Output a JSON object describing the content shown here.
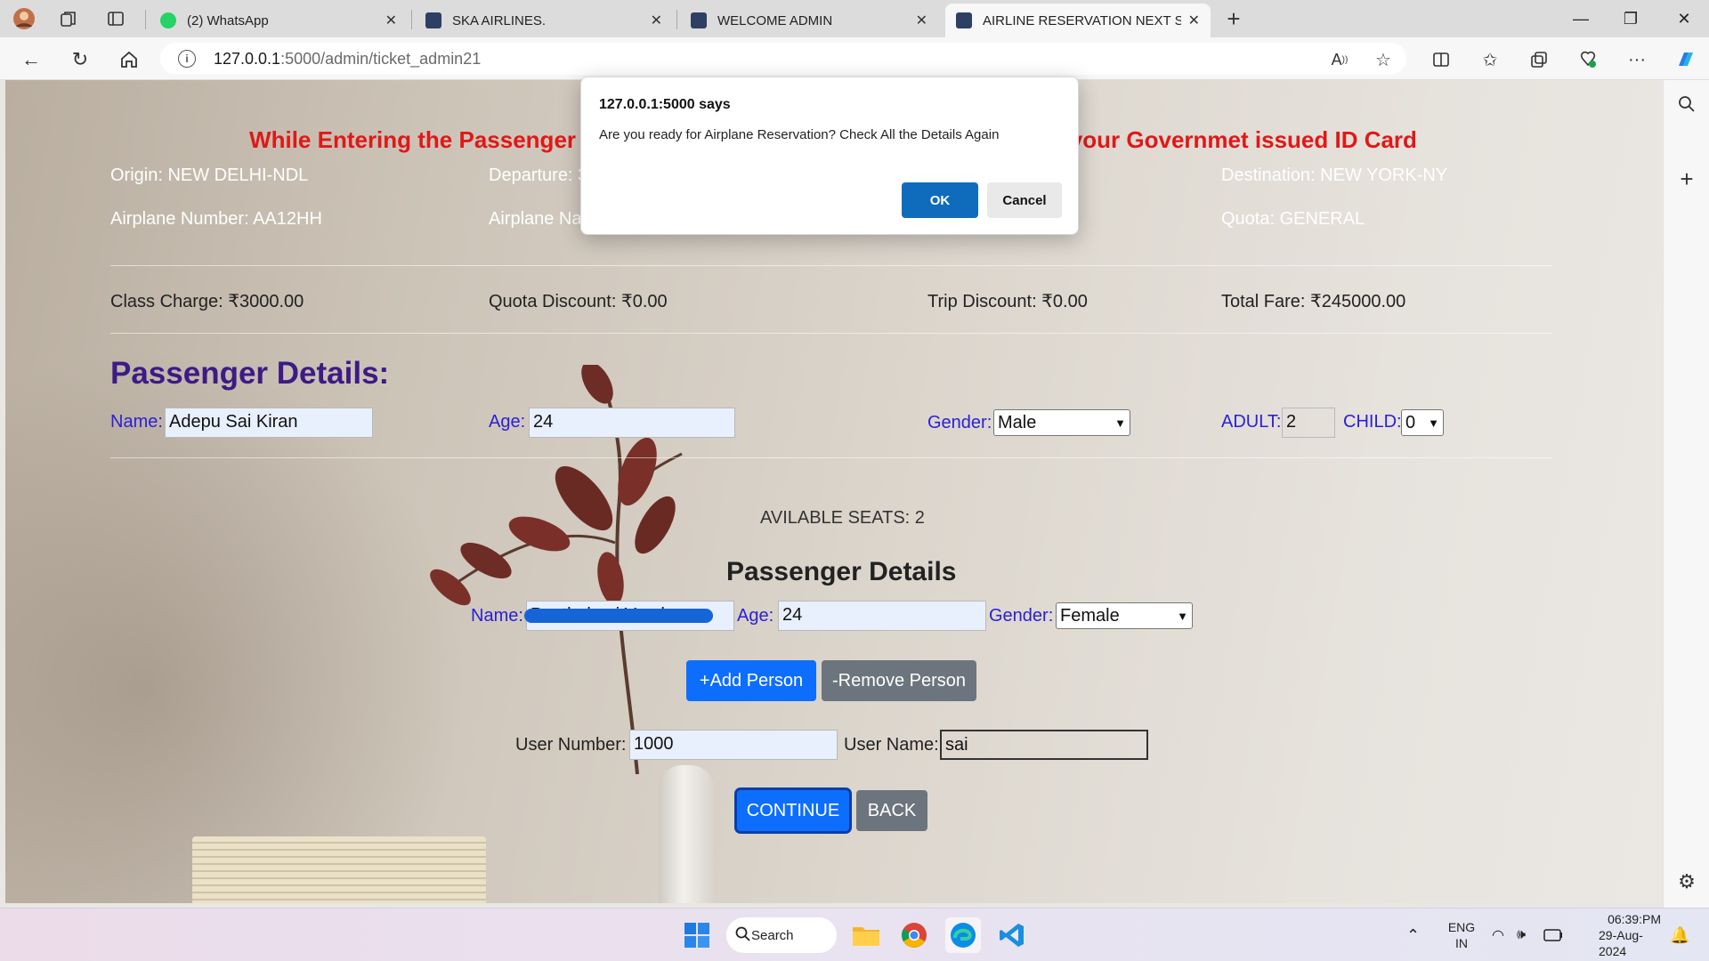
{
  "browser": {
    "tabs": [
      {
        "title": "(2) WhatsApp",
        "active": false
      },
      {
        "title": "SKA AIRLINES.",
        "active": false
      },
      {
        "title": "WELCOME ADMIN",
        "active": false
      },
      {
        "title": "AIRLINE RESERVATION NEXT STEP",
        "active": true
      }
    ],
    "url_host": "127.0.0.1",
    "url_path": ":5000/admin/ticket_admin21"
  },
  "page": {
    "warning_left": "While Entering the Passenger De",
    "warning_right": "f your Governmet issued ID Card",
    "origin": "Origin: NEW DELHI-NDL",
    "departure": "Departure: 3",
    "destination": "Destination: NEW YORK-NY",
    "airplane_number": "Airplane Number: AA12HH",
    "airplane_name": "Airplane Na",
    "quota": "Quota: GENERAL",
    "class_charge": "Class Charge: ₹3000.00",
    "quota_discount": "Quota Discount: ₹0.00",
    "trip_discount": "Trip Discount: ₹0.00",
    "total_fare": "Total Fare: ₹245000.00",
    "passenger_heading": "Passenger Details:",
    "name_label": "Name:",
    "name_value": "Adepu Sai Kiran",
    "age_label": "Age:",
    "age_value": "24",
    "gender_label": "Gender:",
    "gender_value": "Male",
    "adult_label": "ADULT:",
    "adult_value": "2",
    "child_label": "CHILD:",
    "child_value": "0",
    "available_seats": "AVILABLE SEATS: 2",
    "passenger_details_sub": "Passenger Details",
    "p2_name_label": "Name:",
    "p2_name_value": "Panthakani Vandana",
    "p2_age_label": "Age:",
    "p2_age_value": "24",
    "p2_gender_label": "Gender:",
    "p2_gender_value": "Female",
    "add_person": "+Add Person",
    "remove_person": "-Remove Person",
    "user_number_label": "User Number:",
    "user_number_value": "1000",
    "user_name_label": "User Name:",
    "user_name_value": "sai",
    "continue": "CONTINUE",
    "back": "BACK"
  },
  "dialog": {
    "title": "127.0.0.1:5000 says",
    "message": "Are you ready for Airplane Reservation? Check All the Details Again",
    "ok": "OK",
    "cancel": "Cancel"
  },
  "taskbar": {
    "search": "Search",
    "lang_top": "ENG",
    "lang_bottom": "IN",
    "time": "06:39:PM",
    "date": "29-Aug-2024"
  }
}
